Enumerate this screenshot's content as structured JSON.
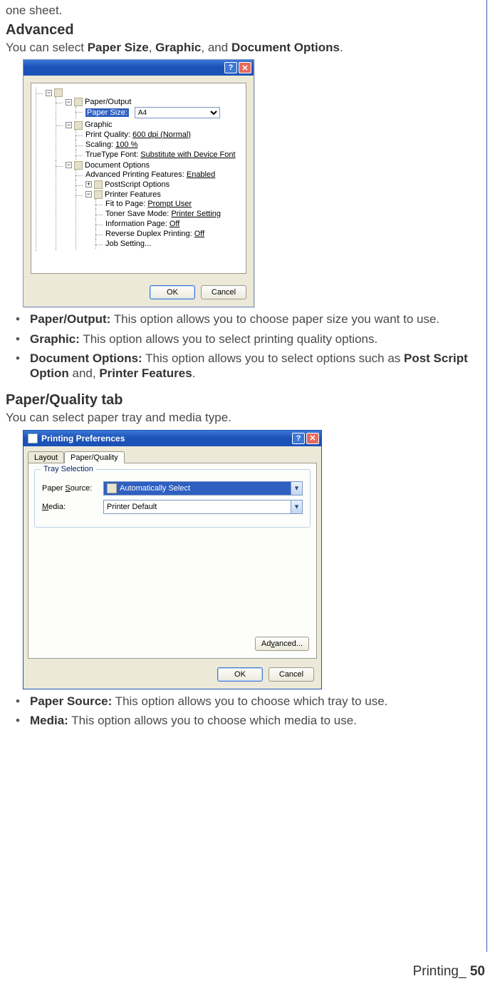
{
  "frag_top": "one sheet.",
  "advanced": {
    "heading": "Advanced",
    "intro_pre": "You can select ",
    "intro_b1": "Paper Size",
    "intro_sep1": ", ",
    "intro_b2": "Graphic",
    "intro_sep2": ", and ",
    "intro_b3": "Document Options",
    "intro_end": "."
  },
  "dialog1": {
    "help": "?",
    "close": "✕",
    "tree": {
      "root": "",
      "paper_output": "Paper/Output",
      "paper_size_label": "Paper Size:",
      "paper_size_value": "A4",
      "graphic": "Graphic",
      "print_quality_l": "Print Quality: ",
      "print_quality_v": "600 dpi (Normal)",
      "scaling_l": "Scaling: ",
      "scaling_v": "100 %",
      "ttf_l": "TrueType Font: ",
      "ttf_v": "Substitute with Device Font",
      "doc_options": "Document Options",
      "apf_l": "Advanced Printing Features: ",
      "apf_v": "Enabled",
      "ps_options": "PostScript Options",
      "printer_features": "Printer Features",
      "fit_l": "Fit to Page: ",
      "fit_v": "Prompt User",
      "toner_l": "Toner Save Mode: ",
      "toner_v": "Printer Setting",
      "info_l": "Information Page: ",
      "info_v": "Off",
      "revdup_l": "Reverse Duplex Printing: ",
      "revdup_v": "Off",
      "jobset": "Job Setting..."
    },
    "ok": "OK",
    "cancel": "Cancel"
  },
  "bullets1": {
    "po_b": "Paper/Output:",
    "po_t": "  This option allows you to choose paper size you want to use.",
    "gr_b": "Graphic:",
    "gr_t": "  This option allows you to select printing quality options.",
    "do_b": "Document Options:",
    "do_t": "  This option allows you to select options such as ",
    "do_b2": "Post Script Option",
    "do_mid": " and, ",
    "do_b3": "Printer Features",
    "do_end": "."
  },
  "pq": {
    "heading": "Paper/Quality tab",
    "intro": "You can select paper tray and media type."
  },
  "dialog2": {
    "title": "Printing Preferences",
    "help": "?",
    "close": "✕",
    "tab_layout": "Layout",
    "tab_pq": "Paper/Quality",
    "group_legend": "Tray Selection",
    "paper_source_label_pre": "Paper ",
    "paper_source_label_u": "S",
    "paper_source_label_post": "ource:",
    "paper_source_value": "Automatically Select",
    "media_label_u": "M",
    "media_label_post": "edia:",
    "media_value": "Printer Default",
    "advanced_btn_pre": "Ad",
    "advanced_btn_u": "v",
    "advanced_btn_post": "anced...",
    "ok": "OK",
    "cancel": "Cancel"
  },
  "bullets2": {
    "ps_b": "Paper Source:",
    "ps_t": "  This option allows you to choose which tray to use.",
    "me_b": "Media:",
    "me_t": "  This option allows you to choose which media to use."
  },
  "footer": {
    "section": "Printing_",
    "page": " 50"
  }
}
